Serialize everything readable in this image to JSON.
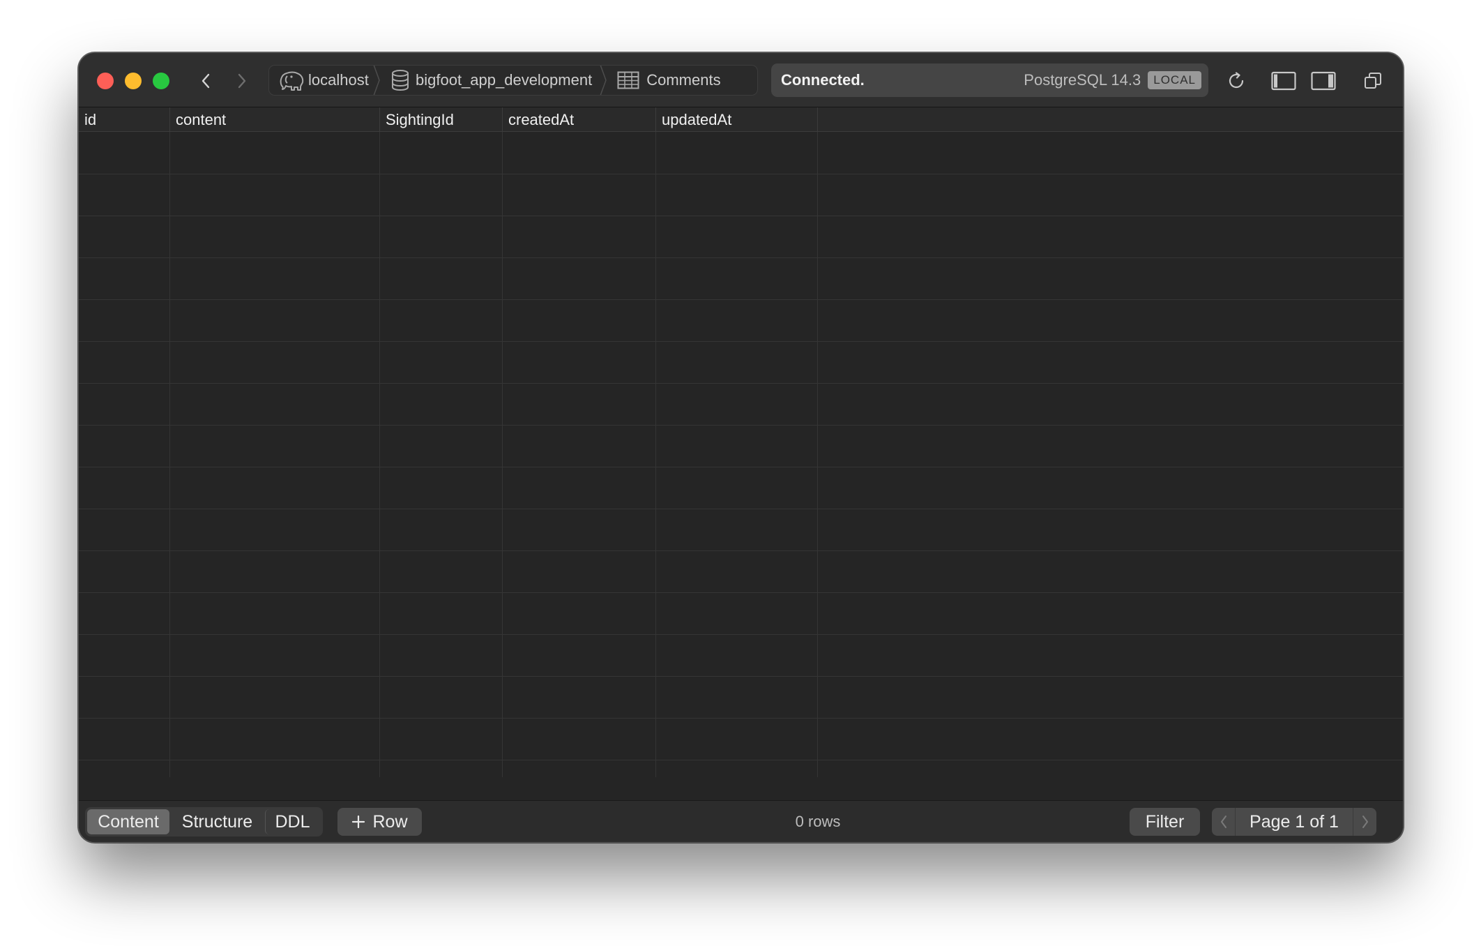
{
  "window": {
    "breadcrumb": {
      "host": "localhost",
      "database": "bigfoot_app_development",
      "table": "Comments"
    },
    "status": {
      "text": "Connected.",
      "db_version": "PostgreSQL 14.3",
      "badge": "LOCAL"
    },
    "icons": {
      "host": "elephant-icon",
      "database": "database-icon",
      "table": "table-icon",
      "refresh": "refresh-icon",
      "left_panel": "sidebar-left-icon",
      "right_panel": "sidebar-right-icon",
      "window": "window-overlap-icon"
    },
    "colors": {
      "close": "#fe5f57",
      "minimize": "#febc2e",
      "maximize": "#28c840",
      "background": "#252525"
    }
  },
  "table": {
    "columns": [
      "id",
      "content",
      "SightingId",
      "createdAt",
      "updatedAt"
    ],
    "rows": []
  },
  "bottom": {
    "tabs": [
      "Content",
      "Structure",
      "DDL"
    ],
    "active_tab": "Content",
    "add_row_label": "Row",
    "row_count": "0 rows",
    "filter_label": "Filter",
    "page_label": "Page 1 of 1"
  }
}
